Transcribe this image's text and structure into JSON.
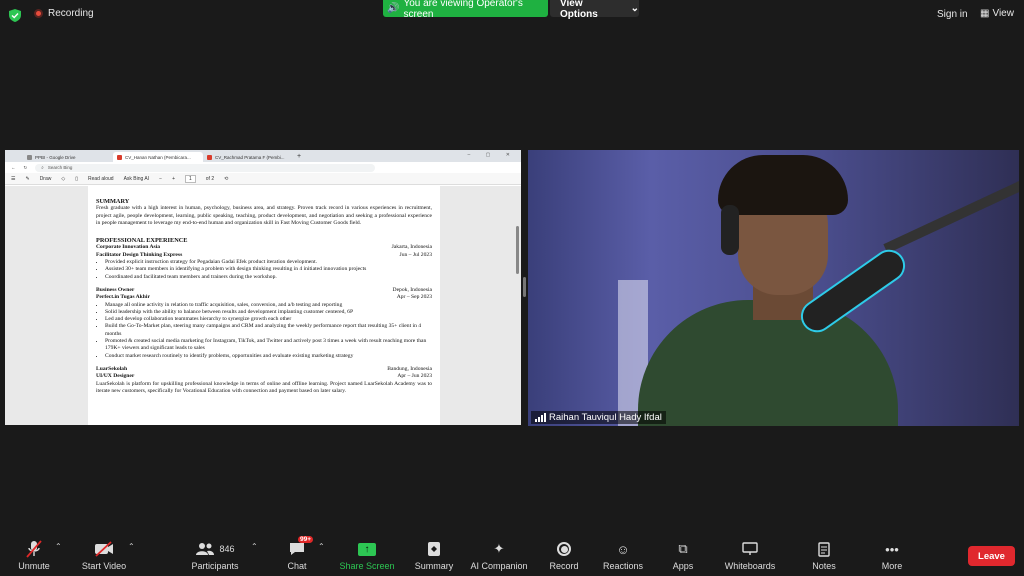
{
  "topbar": {
    "recording_label": "Recording",
    "viewing_banner": "You are viewing Operator's screen",
    "view_options_label": "View Options",
    "sign_in_label": "Sign in",
    "view_label": "View"
  },
  "browser": {
    "tabs": [
      "PPBI - Google Drive",
      "CV_Hanan Nathan (Pembicara...",
      "CV_Rachmad Pratama F (Pembi..."
    ],
    "search_placeholder": "Search Bing",
    "toolbar": {
      "draw_label": "Draw",
      "read_aloud_label": "Read aloud",
      "ask_label": "Ask Bing AI",
      "page_current": "1",
      "page_total": "of 2"
    }
  },
  "document": {
    "summary_heading": "SUMMARY",
    "summary_text": "Fresh graduate with a high interest in human, psychology, business area, and strategy. Proven track record in various experiences in recruitment, project agile, people development, learning, public speaking, teaching, product development, and negotiation and seeking a professional experience in people management to leverage my end-to-end human and organization skill in Fast Moving Customer Goods field.",
    "experience_heading": "PROFESSIONAL EXPERIENCE",
    "jobs": [
      {
        "org": "Corporate Innovation Asia",
        "location": "Jakarta, Indonesia",
        "role": "Facilitator Design Thinking Express",
        "dates": "Jun – Jul 2023",
        "bullets": [
          "Provided explicit instruction strategy for Pegadaian Gadai Efek product iteration development.",
          "Assisted 30+ team members in identifying a problem with design thinking resulting in 4 initiated innovation projects",
          "Coordinated and facilitated team members and trainers during the workshop."
        ]
      },
      {
        "org": "Business Owner",
        "location": "Depok, Indonesia",
        "role": "Perfect.in Tugas Akhir",
        "dates": "Apr – Sep 2023",
        "bullets": [
          "Manage all online activity in relation to traffic acquisition, sales, conversion, and a/b testing and reporting",
          "Solid leadership with the ability to balance between results and development implanting customer centered, 6P",
          "Led and develop collaboration teammates hierarchy to synergize growth each other",
          "Build the Go-To-Market plan, steering many campaigns and CRM and analyzing the weekly performance report that resulting 35+ client in 4 months",
          "Promoted & created social media marketing for Instagram, TikTok, and Twitter and actively post 3 times a week with result reaching more than 179K+ viewers and significant leads to sales",
          "Conduct market research routinely to identify problems, opportunities and evaluate existing marketing strategy"
        ]
      },
      {
        "org": "LuarSekolah",
        "location": "Bandung, Indonesia",
        "role": "UI/UX Designer",
        "dates": "Apr – Jun 2023",
        "paragraph": "LuarSekolah is platform for upskilling professional knowledge in terms of online and offline learning. Project named LuarSekolah Academy was to iterate new customers, specifically for Vocational Education with connection and payment based on later salary."
      }
    ]
  },
  "video": {
    "participant_name": "Raihan Tauviqul Hady Ifdal"
  },
  "toolbar": {
    "unmute": "Unmute",
    "start_video": "Start Video",
    "participants": "Participants",
    "participants_count": "846",
    "chat": "Chat",
    "chat_badge": "99+",
    "share_screen": "Share Screen",
    "summary": "Summary",
    "ai_companion": "AI Companion",
    "record": "Record",
    "reactions": "Reactions",
    "apps": "Apps",
    "whiteboards": "Whiteboards",
    "notes": "Notes",
    "more": "More",
    "leave": "Leave"
  },
  "colors": {
    "share_green": "#2dc653",
    "leave_red": "#e0282e",
    "banner_green": "#1fb141"
  }
}
